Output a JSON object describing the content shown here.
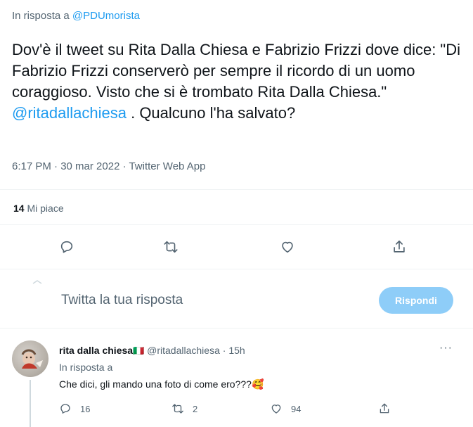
{
  "reply_context": {
    "prefix": "In risposta a",
    "mention": "@PDUmorista"
  },
  "tweet": {
    "text_part1": "Dov'è il tweet su Rita Dalla Chiesa e Fabrizio Frizzi dove dice: \"Di Fabrizio Frizzi conserverò per sempre il ricordo di un uomo coraggioso. Visto che si  è trombato Rita Dalla Chiesa.\" ",
    "text_mention": "@ritadallachiesa",
    "text_part2": " . Qualcuno l'ha salvato?",
    "meta": "6:17 PM · 30 mar 2022 · Twitter Web App",
    "likes_count": "14",
    "likes_label": "Mi piace"
  },
  "actions": {
    "icons": [
      "reply-icon",
      "retweet-icon",
      "like-icon",
      "share-icon"
    ]
  },
  "composer": {
    "placeholder": "Twitta la tua risposta",
    "reply_button": "Rispondi",
    "button_color": "#8ecdf8"
  },
  "reply": {
    "name": "rita dalla chiesa",
    "flag": "🇮🇹",
    "handle": "@ritadallachiesa",
    "time": "15h",
    "more": "···",
    "reply_to": "In risposta a",
    "text": "Che dici, gli mando una foto di come ero???🥰",
    "replies": "16",
    "retweets": "2",
    "likes": "94"
  },
  "colors": {
    "accent": "#1d9bf0",
    "muted": "#536471",
    "text": "#0f1419",
    "divider": "#eff3f4"
  }
}
